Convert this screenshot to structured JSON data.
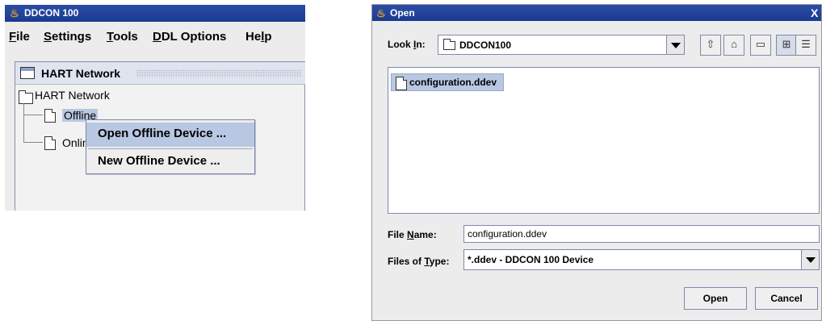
{
  "main_window": {
    "title": "DDCON 100",
    "icon": "java-cup-icon",
    "menu": [
      {
        "label": "File",
        "mnemonic": "F",
        "rest": "ile"
      },
      {
        "label": "Settings",
        "mnemonic": "S",
        "rest": "ettings"
      },
      {
        "label": "Tools",
        "mnemonic": "T",
        "rest": "ools"
      },
      {
        "label": "DDL Options",
        "mnemonic": "D",
        "rest": "DL Options"
      },
      {
        "label": "Help",
        "pre": "He",
        "mnemonic": "l",
        "rest": "p"
      }
    ],
    "internal_frame_title": "HART Network",
    "tree": {
      "root": "HART Network",
      "children": [
        "Offline",
        "Online"
      ]
    },
    "context_menu": {
      "items": [
        "Open Offline Device ...",
        "New Offline Device ..."
      ],
      "selected_index": 0
    }
  },
  "open_dialog": {
    "title": "Open",
    "close_glyph": "X",
    "look_in_label": {
      "pre": "Look ",
      "mnemonic": "I",
      "rest": "n:"
    },
    "look_in_value": "DDCON100",
    "toolbar_icons": [
      "up-folder-icon",
      "home-icon",
      "new-folder-icon",
      "list-view-icon",
      "details-view-icon"
    ],
    "files": [
      "configuration.ddev"
    ],
    "file_name_label": {
      "pre": "File ",
      "mnemonic": "N",
      "rest": "ame:"
    },
    "file_name_value": "configuration.ddev",
    "files_of_type_label": {
      "pre": "Files of ",
      "mnemonic": "T",
      "rest": "ype:"
    },
    "files_of_type_value": "*.ddev - DDCON 100 Device",
    "open_button": "Open",
    "cancel_button": "Cancel"
  },
  "colors": {
    "titlebar": "#1f45a0",
    "selection": "#b8c8e2",
    "window_bg": "#ececec"
  }
}
